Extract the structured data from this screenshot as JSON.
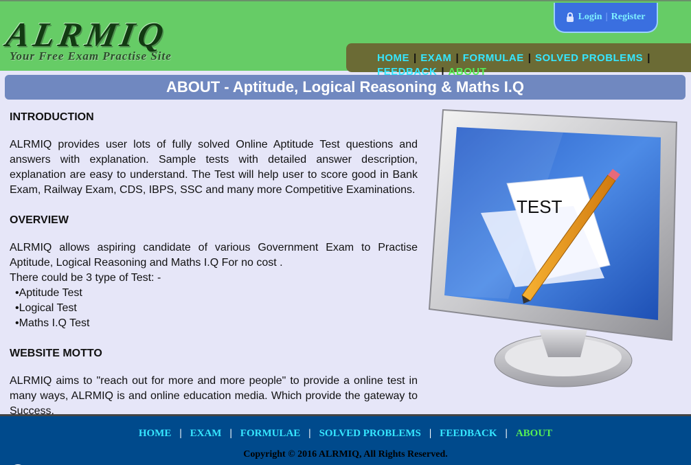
{
  "header": {
    "logo_title": "ALRMIQ",
    "logo_subtitle": "Your Free Exam Practise Site",
    "login_label": "Login",
    "auth_separator": "|",
    "register_label": "Register",
    "nav": [
      {
        "label": "HOME"
      },
      {
        "label": "EXAM"
      },
      {
        "label": "FORMULAE"
      },
      {
        "label": "SOLVED PROBLEMS"
      },
      {
        "label": "FEEDBACK"
      },
      {
        "label": "ABOUT"
      }
    ],
    "nav_separator": "|"
  },
  "page_title": "ABOUT - Aptitude, Logical Reasoning & Maths I.Q",
  "sections": {
    "intro": {
      "heading": "INTRODUCTION",
      "text": "ALRMIQ provides user lots of fully solved Online Aptitude Test questions and answers with explanation. Sample tests with detailed answer description, explanation are easy to understand. The Test will help user to score good in Bank Exam, Railway Exam, CDS, IBPS, SSC and many more Competitive Examinations."
    },
    "overview": {
      "heading": "OVERVIEW",
      "text": "ALRMIQ allows aspiring candidate of various Government Exam to Practise Aptitude, Logical Reasoning and Maths I.Q For no cost .",
      "types_intro": "There could be 3 type of Test: -",
      "types": [
        "Aptitude Test",
        "Logical Test",
        "Maths I.Q Test"
      ]
    },
    "motto": {
      "heading": "WEBSITE MOTTO",
      "text": "ALRMIQ aims to \"reach out for more and more people\" to provide a online test in many ways, ALRMIQ is and online education media. Which provide the gateway to Success."
    }
  },
  "illustration": {
    "screen_text": "TEST"
  },
  "footer": {
    "nav": [
      {
        "label": "HOME"
      },
      {
        "label": "EXAM"
      },
      {
        "label": "FORMULAE"
      },
      {
        "label": "SOLVED PROBLEMS"
      },
      {
        "label": "FEEDBACK"
      },
      {
        "label": "ABOUT"
      }
    ],
    "separator": "|",
    "copyright": "Copyright © 2016 ALRMIQ, All Rights Reserved."
  },
  "colors": {
    "header_bg": "#66cc66",
    "nav_bg": "#6b6b35",
    "link_cyan": "#36e6ff",
    "link_active_green": "#55ee55",
    "title_bar": "#7088c0",
    "page_bg": "#e6e6f8",
    "footer_bg": "#004a8c"
  },
  "icons": {
    "login": "lock-icon"
  }
}
